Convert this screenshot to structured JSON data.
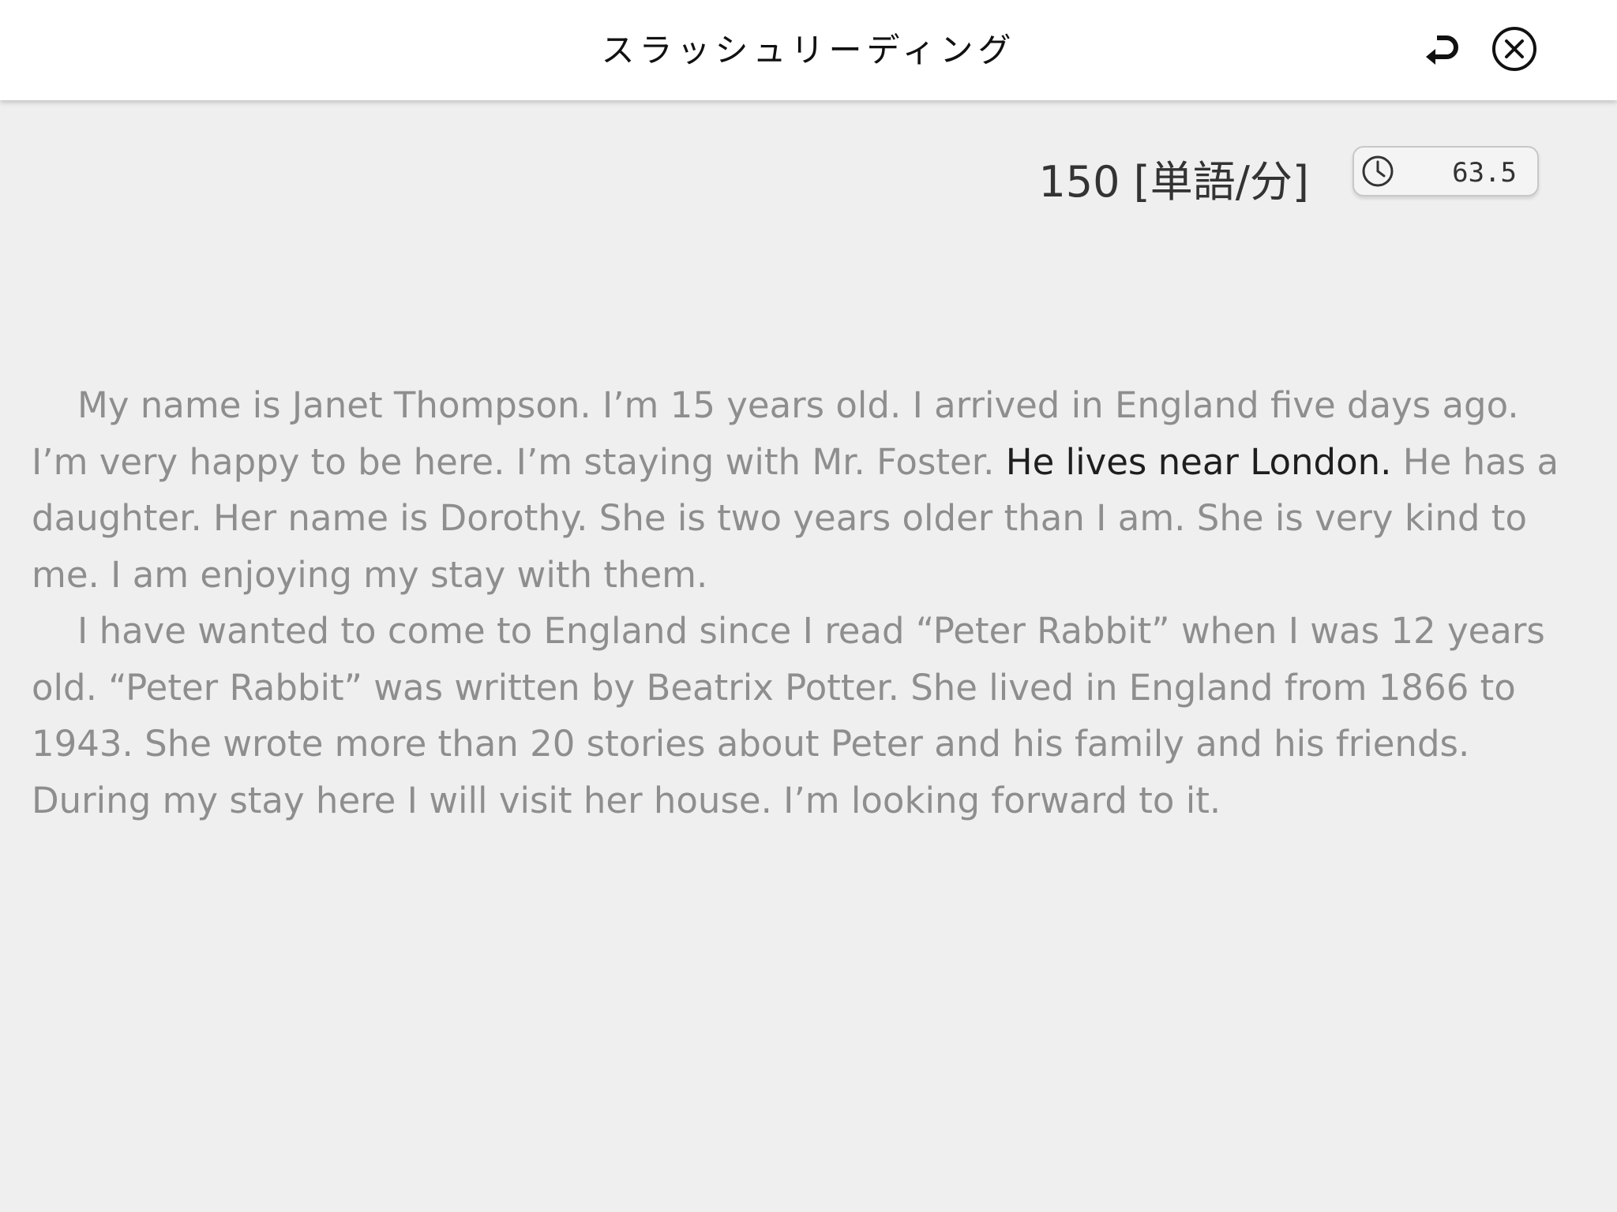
{
  "header": {
    "title": "スラッシュリーディング",
    "back_icon": "return-arrow-icon",
    "close_icon": "close-circle-icon"
  },
  "stats": {
    "speed": "150 [単語/分]",
    "timer_icon": "clock-icon",
    "timer_value": "63.5"
  },
  "passage": {
    "p1_before": "My name is Janet Thompson. I’m 15 years old. I arrived in England five days ago. I’m very happy to be here. I’m staying with Mr. Foster. ",
    "p1_highlight": "He lives near London.",
    "p1_after": " He has a daughter. Her name is Dorothy. She is two years older than I am. She is very kind to me. I am enjoying my stay with them.",
    "p2": "I have wanted to come to England since I read “Peter Rabbit” when I was 12 years old. “Peter Rabbit” was written by Beatrix Potter. She lived in England from 1866 to 1943. She wrote more than 20 stories about Peter and his family and his friends. During my stay here I will visit her house. I’m looking forward to it."
  },
  "colors": {
    "background": "#efefef",
    "header_bg": "#ffffff",
    "text_dim": "#8e8e8e",
    "text_highlight": "#1e1e1e"
  }
}
